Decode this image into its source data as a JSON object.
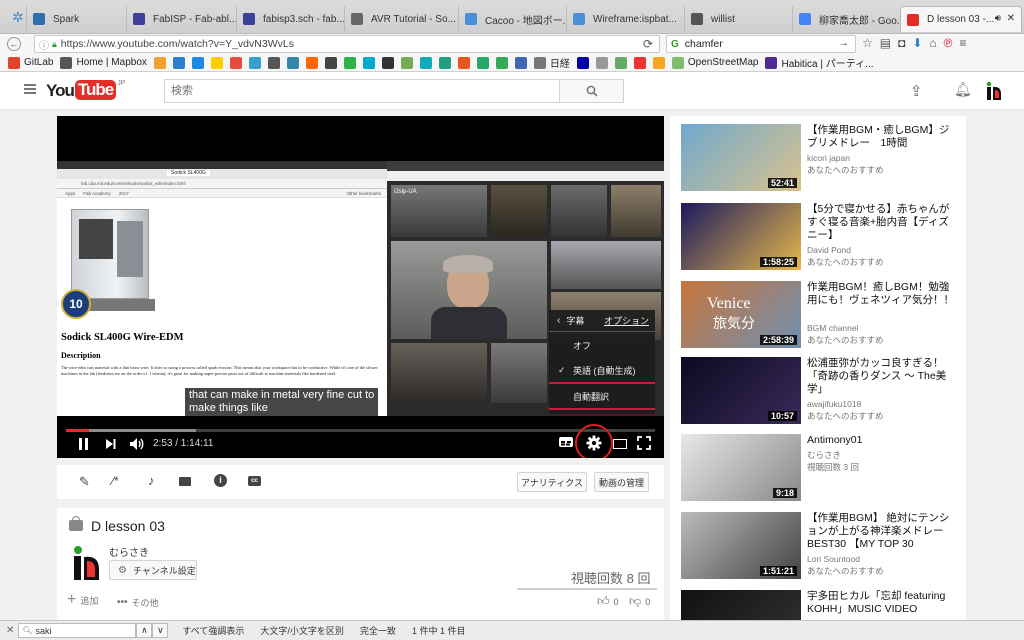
{
  "tabs": [
    {
      "title": "Spark",
      "color": "#2f6fb0"
    },
    {
      "title": "FabISP - Fab-abl...",
      "color": "#3b3f9a"
    },
    {
      "title": "fabisp3.sch - fab...",
      "color": "#3b3f9a"
    },
    {
      "title": "AVR Tutorial - So...",
      "color": "#666666"
    },
    {
      "title": "Cacoo - 地図ボー...",
      "color": "#4a90d9"
    },
    {
      "title": "Wireframe:ispbat...",
      "color": "#4a90d9"
    },
    {
      "title": "willist",
      "color": "#555555"
    },
    {
      "title": "柳家喬太郎 - Goo...",
      "color": "#4285f4"
    },
    {
      "title": "D lesson 03 -...",
      "color": "#e52d27"
    }
  ],
  "url": "https://www.youtube.com/watch?v=Y_vdvN3WvLs",
  "search_engine_query": "chamfer",
  "bookmarks": [
    {
      "label": "GitLab",
      "color": "#e2432a"
    },
    {
      "label": "Home | Mapbox",
      "color": "#555555"
    },
    {
      "label": "日経",
      "color": "#777777"
    },
    {
      "label": "OpenStreetMap",
      "color": "#7ebc6f"
    },
    {
      "label": "Habitica | パーティ...",
      "color": "#4f2a93"
    }
  ],
  "bookmark_icon_colors": [
    "#f0a030",
    "#2c7fd0",
    "#1e88e5",
    "#ffcc00",
    "#e74c3c",
    "#3aa0c9",
    "#555",
    "#38a",
    "#f60",
    "#444",
    "#2db34a",
    "#0ac",
    "#333",
    "#7a5",
    "#1ab",
    "#20a080",
    "#e95420",
    "#2a6",
    "#3a5",
    "#4267b2",
    "#00a",
    "#999",
    "#6a6",
    "#e33",
    "#f5a623"
  ],
  "youtube": {
    "logo_you": "You",
    "logo_tube": "Tube",
    "region": "JP",
    "search_placeholder": "検索"
  },
  "player": {
    "time": "2:53 / 1:14:11",
    "progress": 0.039,
    "caption_line1": "that can make in metal very fine cut to",
    "caption_line2": "make things like",
    "settings_menu": {
      "header": "字幕",
      "options": "オプション",
      "items": [
        "オフ",
        "英語 (自動生成)",
        "自動翻訳"
      ],
      "checked_index": 1
    },
    "screen": {
      "browser_tab": "Sodick SL400G",
      "url": "fab.cba.mit.edu/content/tools/sodick_edm/index.html",
      "bookmark_apps": "Apps",
      "bookmark_fab": "Fab Academy",
      "bookmark_year": "2017",
      "other_bookmarks": "Other bookmarks",
      "heading": "Sodick SL400G Wire-EDM",
      "section": "Description",
      "body": "The wire-edm cuts material with a thin brass wire. It does so using a process called spark erosion. This means that your workspace has to be conductive. While it's one of the slower machines in the lab (feedrates are on the order of .1 in/min), it's great for making super-precise parts out of difficult to machine materials like hardened steel.",
      "badge": "10",
      "video_label": "i2sip-UA"
    }
  },
  "toolbar": {
    "analytics": "アナリティクス",
    "manage": "動画の管理"
  },
  "video": {
    "title": "D lesson 03",
    "channel": "むらさき",
    "channel_settings": "チャンネル設定",
    "views": "視聴回数 8 回",
    "add": "追加",
    "more": "その他",
    "likes": "0",
    "dislikes": "0"
  },
  "recommendations": [
    {
      "title": "【作業用BGM・癒しBGM】ジブリメドレー　1時間",
      "channel": "kicori japan",
      "meta": "あなたへのおすすめ",
      "duration": "52:41",
      "c1": "#6fa8cf",
      "c2": "#d9c28c"
    },
    {
      "title": "【5分で寝かせる】赤ちゃんがすぐ寝る音楽+胎内音【ディズニー】",
      "channel": "David Pond",
      "meta": "あなたへのおすすめ",
      "duration": "1:58:25",
      "c1": "#1a1a5e",
      "c2": "#e8b84c"
    },
    {
      "title": "作業用BGM！癒しBGM！勉強用にも！ヴェネツィア気分！！",
      "channel": "BGM channel",
      "meta": "あなたへのおすすめ",
      "duration": "2:58:39",
      "c1": "#c8763c",
      "c2": "#6f8fb0",
      "overlay1": "Venice",
      "overlay2": "旅気分"
    },
    {
      "title": "松浦亜弥がカッコ良すぎる！「奇跡の香りダンス 〜 The美学」",
      "channel": "awajifuku1018",
      "meta": "あなたへのおすすめ",
      "duration": "10:57",
      "c1": "#0a0a20",
      "c2": "#3a2a5a"
    },
    {
      "title": "Antimony01",
      "channel": "むらさき",
      "meta": "視聴回数 3 回",
      "duration": "9:18",
      "c1": "#e8e8e8",
      "c2": "#888888"
    },
    {
      "title": "【作業用BGM】 絶対にテンションが上がる神洋楽メドレーBEST30 【MY TOP 30",
      "channel": "Lori Sountood",
      "meta": "あなたへのおすすめ",
      "duration": "1:51:21",
      "c1": "#bbbbbb",
      "c2": "#444444"
    },
    {
      "title": "宇多田ヒカル「忘却 featuring KOHH」MUSIC VIDEO",
      "channel": "",
      "meta": "",
      "duration": "",
      "c1": "#111111",
      "c2": "#333333"
    }
  ],
  "findbar": {
    "query": "saki",
    "highlight_all": "すべて強調表示",
    "match_case": "大文字/小文字を区別",
    "whole_word": "完全一致",
    "count": "1 件中 1 件目"
  }
}
